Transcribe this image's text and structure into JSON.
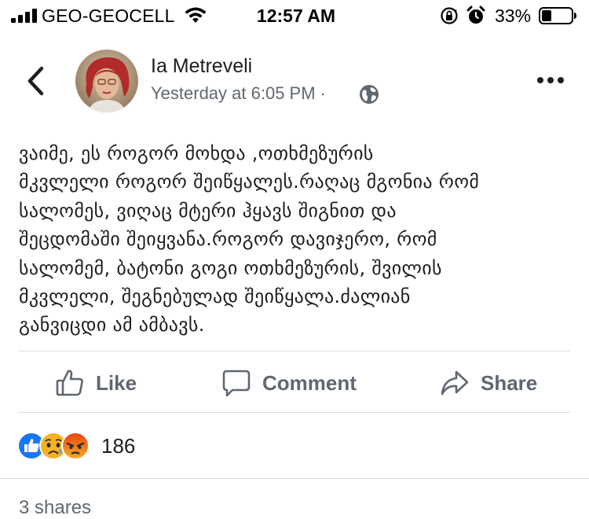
{
  "status_bar": {
    "carrier": "GEO-GEOCELL",
    "time": "12:57 AM",
    "battery_percent": "33%",
    "icons": [
      "signal-icon",
      "wifi-icon",
      "rotation-lock-icon",
      "alarm-icon",
      "battery-icon"
    ]
  },
  "post": {
    "author": "Ia Metreveli",
    "timestamp": "Yesterday at 6:05 PM",
    "separator": "·",
    "privacy_icon": "globe-icon",
    "text_lines": [
      "ვაიმე,  ეს როგორ მოხდა ,ოთხმეზურის",
      "მკვლელი როგორ შეიწყალეს.რაღაც მგონია რომ",
      "სალომეს, ვიღაც მტერი ჰყავს შიგნით და",
      "შეცდომაში შეიყვანა.როგორ დავიჯერო, რომ",
      "სალომემ, ბატონი გოგი ოთხმეზურის, შვილის",
      "მკვლელი, შეგნებულად შეიწყალა.ძალიან",
      "განვიცდი ამ ამბავს."
    ]
  },
  "actions": {
    "like": "Like",
    "comment": "Comment",
    "share": "Share"
  },
  "reactions": {
    "types": [
      "like",
      "sad",
      "angry"
    ],
    "count": "186"
  },
  "shares": "3 shares",
  "colors": {
    "meta_gray": "#606770",
    "text": "#1c1e21",
    "divider": "#dadde1",
    "like_blue": "#1877f2",
    "angry_orange": "#e9710f",
    "sad_yellow": "#f7b125"
  }
}
